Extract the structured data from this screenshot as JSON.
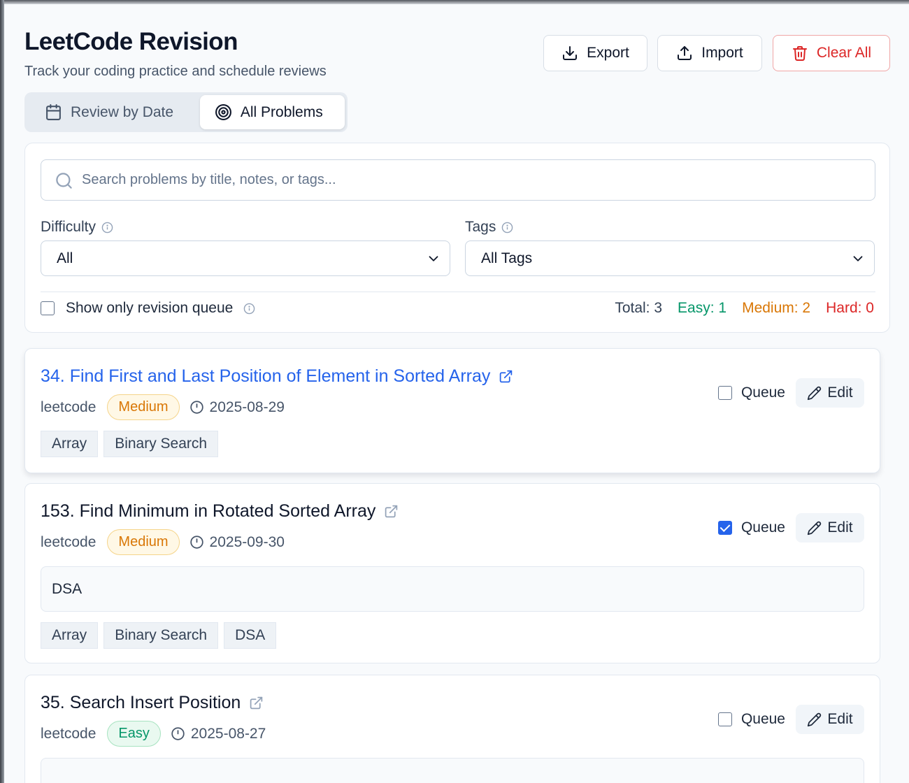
{
  "header": {
    "title": "LeetCode Revision",
    "subtitle": "Track your coding practice and schedule reviews",
    "export_label": "Export",
    "import_label": "Import",
    "clear_label": "Clear All"
  },
  "tabs": [
    {
      "label": "Review by Date",
      "icon": "calendar-icon",
      "active": false
    },
    {
      "label": "All Problems",
      "icon": "target-icon",
      "active": true
    }
  ],
  "filters": {
    "search_placeholder": "Search problems by title, notes, or tags...",
    "search_value": "",
    "difficulty_label": "Difficulty",
    "difficulty_value": "All",
    "tags_label": "Tags",
    "tags_value": "All Tags",
    "queue_only_label": "Show only revision queue",
    "queue_only_checked": false
  },
  "stats": {
    "total": "Total: 3",
    "easy": "Easy: 1",
    "medium": "Medium: 2",
    "hard": "Hard: 0"
  },
  "colors": {
    "accent": "#2563eb",
    "easy": "#059669",
    "medium": "#d97706",
    "hard": "#dc2626"
  },
  "problems": [
    {
      "title": "34. Find First and Last Position of Element in Sorted Array",
      "source": "leetcode",
      "difficulty": "Medium",
      "date": "2025-08-29",
      "note": "",
      "tags": [
        "Array",
        "Binary Search"
      ],
      "queued": false,
      "queue_label": "Queue",
      "edit_label": "Edit"
    },
    {
      "title": "153. Find Minimum in Rotated Sorted Array",
      "source": "leetcode",
      "difficulty": "Medium",
      "date": "2025-09-30",
      "note": "DSA",
      "tags": [
        "Array",
        "Binary Search",
        "DSA"
      ],
      "queued": true,
      "queue_label": "Queue",
      "edit_label": "Edit"
    },
    {
      "title": "35. Search Insert Position",
      "source": "leetcode",
      "difficulty": "Easy",
      "date": "2025-08-27",
      "note": "",
      "tags": [],
      "queued": false,
      "queue_label": "Queue",
      "edit_label": "Edit"
    }
  ]
}
